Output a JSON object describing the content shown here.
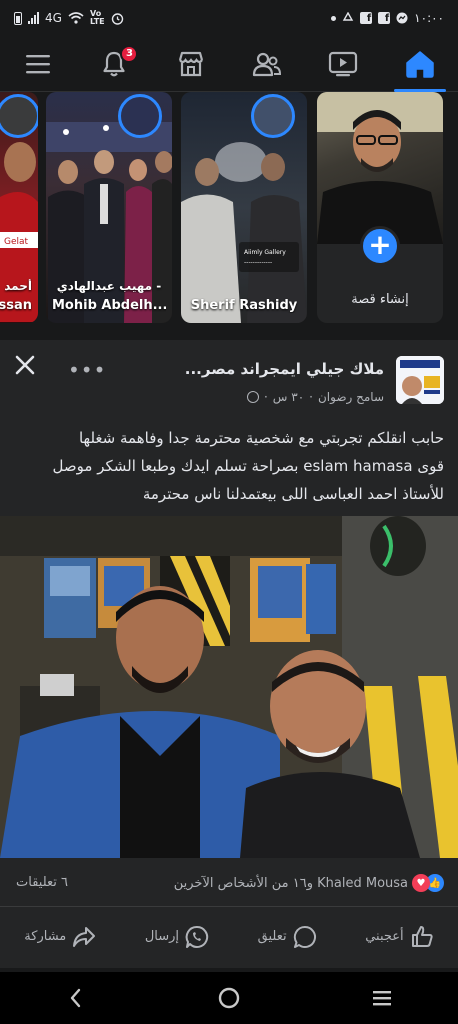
{
  "status_bar": {
    "network": "4G",
    "time": "١٠:٠٠"
  },
  "nav": {
    "notifications_count": "3",
    "active_tab": "home"
  },
  "stories": [
    {
      "name_line1": "أحمد",
      "name_line2": "ssan",
      "avatar_text": ""
    },
    {
      "name_line1": "مهيب عبدالهادي -",
      "name_line2": "Mohib Abdelh..."
    },
    {
      "name_line1": "",
      "name_line2": "Sherif Rashidy"
    },
    {
      "create_label": "إنشاء قصة"
    }
  ],
  "post": {
    "page_name": "ملاك جيلي ايمجراند مصر...",
    "author": "سامح رضوان",
    "time": "٣٠ س",
    "meta_sep": "·",
    "text_line1": "حابب انقلكم تجربتي مع شخصية محترمة جدا وفاهمة شغلها",
    "text_line2": "قوى eslam hamasa بصراحة تسلم ايدك وطبعا الشكر موصل",
    "text_line3": "للأستاذ احمد العباسى اللى بيعتمدلنا ناس محترمة",
    "reactions_text": "Khaled Mousa و١٦ من الأشخاص الآخرين",
    "comments_count": "٦ تعليقات",
    "like_label": "أعجبني",
    "comment_label": "تعليق",
    "send_label": "إرسال",
    "share_label": "مشاركة"
  },
  "colors": {
    "accent": "#2d88ff",
    "background": "#18191a",
    "card": "#242526",
    "badge": "#e41e3f"
  }
}
